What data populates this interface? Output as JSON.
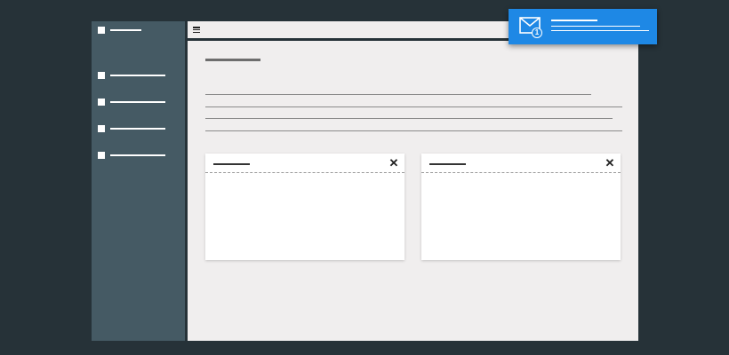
{
  "sidebar": {
    "items": [
      {
        "icon": "checkbox-icon",
        "label": ""
      },
      {
        "icon": "checkbox-icon",
        "label": ""
      },
      {
        "icon": "checkbox-icon",
        "label": ""
      },
      {
        "icon": "checkbox-icon",
        "label": ""
      },
      {
        "icon": "checkbox-icon",
        "label": ""
      }
    ]
  },
  "topbar": {
    "menu_icon": "hamburger-menu-icon"
  },
  "cards": [
    {
      "title": "",
      "close_icon": "close-icon",
      "close_symbol": "✕"
    },
    {
      "title": "",
      "close_icon": "close-icon",
      "close_symbol": "✕"
    }
  ],
  "notification": {
    "icon": "mail-icon",
    "badge_count": "1",
    "text": ""
  },
  "colors": {
    "background": "#263238",
    "sidebar": "#455a64",
    "main": "#f0eeee",
    "accent": "#1e88e5",
    "card": "#ffffff"
  }
}
